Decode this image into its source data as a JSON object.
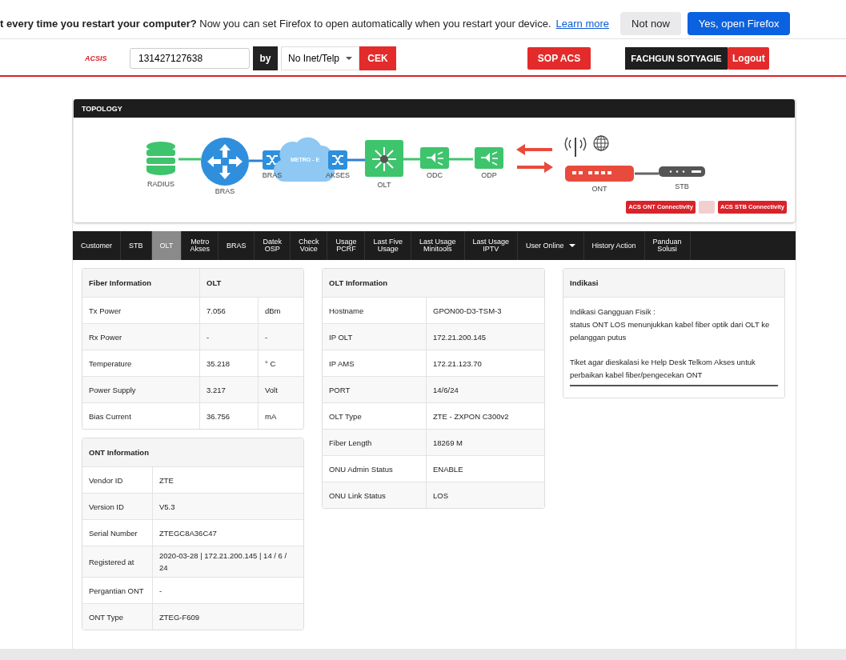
{
  "notification": {
    "text": "**t every time you restart your computer?** Now you can set Firefox to open automatically when you restart your device.",
    "link": "Learn more",
    "buttons": [
      {
        "label": "Not now",
        "kind": "secondary"
      },
      {
        "label": "Yes, open Firefox",
        "kind": "primary"
      }
    ]
  },
  "header": {
    "logo": "ACSIS",
    "search": {
      "value": "131427127638"
    },
    "by_label": "by",
    "filter": {
      "value": "No Inet/Telp"
    },
    "submit": "CEK",
    "sop_button": "SOP ACS",
    "user": "FACHGUN SOTYAGIE",
    "logout": "Logout"
  },
  "topology": {
    "title": "TOPOLOGY",
    "nodes": [
      {
        "kind": "database",
        "label": "RADIUS"
      },
      {
        "kind": "router",
        "label": "BRAS"
      },
      {
        "kind": "switch",
        "label": "BRAS"
      },
      {
        "kind": "cloud",
        "label": "METRO - E"
      },
      {
        "kind": "switch",
        "label": "AKSES"
      },
      {
        "kind": "olt",
        "label": "OLT"
      },
      {
        "kind": "splitter",
        "label": "ODC"
      },
      {
        "kind": "splitter",
        "label": "ODP"
      },
      {
        "kind": "link"
      },
      {
        "kind": "ont",
        "label": "ONT"
      },
      {
        "kind": "stb",
        "label": "STB"
      }
    ],
    "buttons": [
      {
        "kind": "action",
        "label": "ACS ONT Connectivity"
      },
      {
        "kind": "faint"
      },
      {
        "kind": "action",
        "label": "ACS STB Connectivity"
      }
    ]
  },
  "tabs": [
    {
      "label": "Customer",
      "selected": false
    },
    {
      "label": "STB",
      "selected": false
    },
    {
      "label": "OLT",
      "selected": true
    },
    {
      "label": "Metro\nAkses",
      "selected": false
    },
    {
      "label": "BRAS",
      "selected": false
    },
    {
      "label": "Datek\nOSP",
      "selected": false
    },
    {
      "label": "Check\nVoice",
      "selected": false
    },
    {
      "label": "Usage\nPCRF",
      "selected": false
    },
    {
      "label": "Last Five\nUsage",
      "selected": false
    },
    {
      "label": "Last Usage\nMinitools",
      "selected": false
    },
    {
      "label": "Last Usage\nIPTV",
      "selected": false
    },
    {
      "label": "User Online",
      "selected": false,
      "has_menu": true
    },
    {
      "label": "History Action",
      "selected": false
    },
    {
      "label": "Panduan\nSolusi",
      "selected": false
    }
  ],
  "fiber_information": {
    "title": "Fiber Information",
    "column_title": "OLT",
    "rows": [
      {
        "label": "Tx Power",
        "value": "7.056",
        "unit": "dBm"
      },
      {
        "label": "Rx Power",
        "value": "-",
        "unit": "-"
      },
      {
        "label": "Temperature",
        "value": "35.218",
        "unit": "° C"
      },
      {
        "label": "Power Supply",
        "value": "3.217",
        "unit": "Volt"
      },
      {
        "label": "Bias Current",
        "value": "36.756",
        "unit": "mA"
      }
    ]
  },
  "ont_information": {
    "title": "ONT Information",
    "rows": [
      {
        "label": "Vendor ID",
        "value": "ZTE"
      },
      {
        "label": "Version ID",
        "value": "V5.3"
      },
      {
        "label": "Serial Number",
        "value": "ZTEGC8A36C47"
      },
      {
        "label": "Registered at",
        "value": "2020-03-28 | 172.21.200.145 | 14 / 6 / 24"
      },
      {
        "label": "Pergantian ONT",
        "value": "-"
      },
      {
        "label": "ONT Type",
        "value": "ZTEG-F609"
      }
    ]
  },
  "olt_information": {
    "title": "OLT Information",
    "rows": [
      {
        "label": "Hostname",
        "value": "GPON00-D3-TSM-3"
      },
      {
        "label": "IP OLT",
        "value": "172.21.200.145"
      },
      {
        "label": "IP AMS",
        "value": "172.21.123.70"
      },
      {
        "label": "PORT",
        "value": "14/6/24"
      },
      {
        "label": "OLT Type",
        "value": "ZTE - ZXPON C300v2"
      },
      {
        "label": "Fiber Length",
        "value": "18269 M"
      },
      {
        "label": "ONU Admin Status",
        "value": "ENABLE"
      },
      {
        "label": "ONU Link Status",
        "value": "LOS"
      }
    ]
  },
  "indikasi": {
    "title": "Indikasi",
    "paragraphs": [
      "Indikasi Gangguan Fisik :\nstatus ONT LOS menunjukkan kabel fiber optik dari OLT ke pelanggan putus",
      "Tiket agar dieskalasi ke Help Desk Telkom Akses untuk perbaikan kabel fiber/pengecekan ONT"
    ]
  }
}
